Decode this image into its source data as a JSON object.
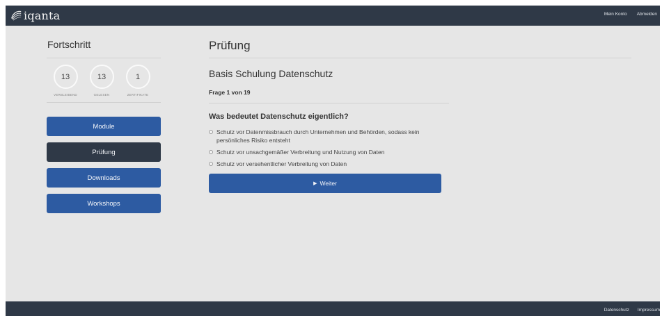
{
  "header": {
    "logo_text": "iqanta",
    "links": [
      "Mein Konto",
      "Abmelden"
    ]
  },
  "sidebar": {
    "title": "Fortschritt",
    "stats": [
      {
        "value": "13",
        "label": "Verbleibend"
      },
      {
        "value": "13",
        "label": "Gelesen"
      },
      {
        "value": "1",
        "label": "Zertifikate"
      }
    ],
    "nav": [
      {
        "label": "Module",
        "active": false
      },
      {
        "label": "Prüfung",
        "active": true
      },
      {
        "label": "Downloads",
        "active": false
      },
      {
        "label": "Workshops",
        "active": false
      }
    ]
  },
  "main": {
    "title": "Prüfung",
    "course_title": "Basis Schulung Datenschutz",
    "question_count": "Frage 1 von 19",
    "question": "Was bedeutet Datenschutz eigentlich?",
    "options": [
      "Schutz vor Datenmissbrauch durch Unternehmen und Behörden, sodass kein persönliches Risiko entsteht",
      "Schutz vor unsachgemäßer Verbreitung und Nutzung von Daten",
      "Schutz vor versehentlicher Verbreitung von Daten"
    ],
    "next_icon": "▶",
    "next_label": "Weiter"
  },
  "footer": {
    "links": [
      "Datenschutz",
      "Impressum"
    ]
  },
  "colors": {
    "bar": "#2f3947",
    "primary": "#2d5ba2",
    "background": "#e6e6e6"
  }
}
